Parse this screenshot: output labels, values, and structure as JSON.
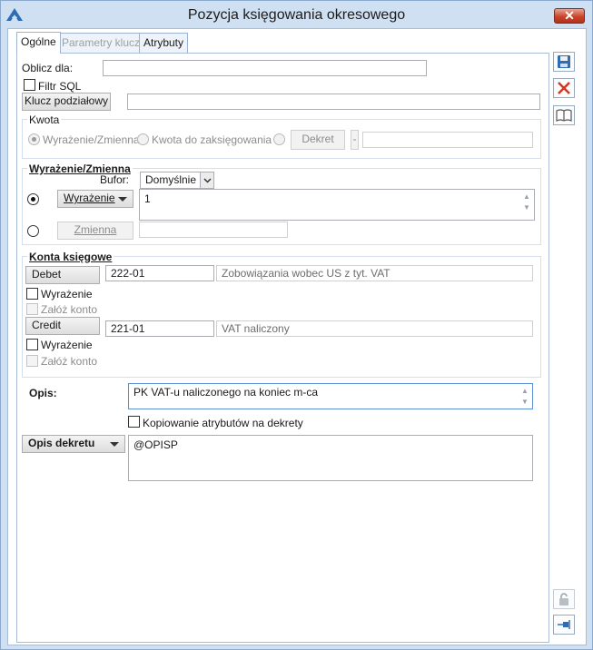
{
  "window": {
    "title": "Pozycja księgowania okresowego",
    "close_glyph": "✕"
  },
  "tabs": [
    {
      "label": "Ogólne",
      "state": "active"
    },
    {
      "label": "Parametry klucza",
      "state": "disabled"
    },
    {
      "label": "Atrybuty",
      "state": "normal"
    }
  ],
  "general": {
    "oblicz_dla_label": "Oblicz dla:",
    "oblicz_dla_value": "",
    "filtr_sql_label": "Filtr SQL",
    "klucz_button": "Klucz podziałowy",
    "klucz_value": ""
  },
  "kwota": {
    "title": "Kwota",
    "opt1": "Wyrażenie/Zmienna",
    "opt2": "Kwota do zaksięgowania",
    "dekret_button": "Dekret",
    "dekret_minus": "-",
    "dekret_value": ""
  },
  "wyrazenie_zmienna": {
    "title": "Wyrażenie/Zmienna",
    "bufor_label": "Bufor:",
    "bufor_value": "Domyślnie",
    "wyrazenie_button": "Wyrażenie",
    "wyrazenie_value": "1",
    "zmienna_button": "Zmienna",
    "zmienna_value": ""
  },
  "konta": {
    "title": "Konta księgowe",
    "debet_button": "Debet",
    "debet_account": "222-01",
    "debet_desc": "Zobowiązania wobec US z tyt. VAT",
    "debet_wyrazenie": "Wyrażenie",
    "debet_zaloz": "Załóż konto",
    "credit_button": "Credit",
    "credit_account": "221-01",
    "credit_desc": "VAT naliczony",
    "credit_wyrazenie": "Wyrażenie",
    "credit_zaloz": "Załóż konto"
  },
  "opis": {
    "label": "Opis:",
    "value": "PK VAT-u naliczonego na koniec m-ca",
    "kopiowanie_label": "Kopiowanie atrybutów na dekrety"
  },
  "opis_dekretu": {
    "button": "Opis dekretu",
    "value": "@OPISP"
  },
  "sidebar_icons": [
    "save-icon",
    "cancel-icon",
    "book-icon",
    "lock-icon",
    "pin-icon"
  ],
  "colors": {
    "accent": "#2e6db6",
    "cancel": "#d8341c",
    "frame": "#cfe0f3"
  }
}
